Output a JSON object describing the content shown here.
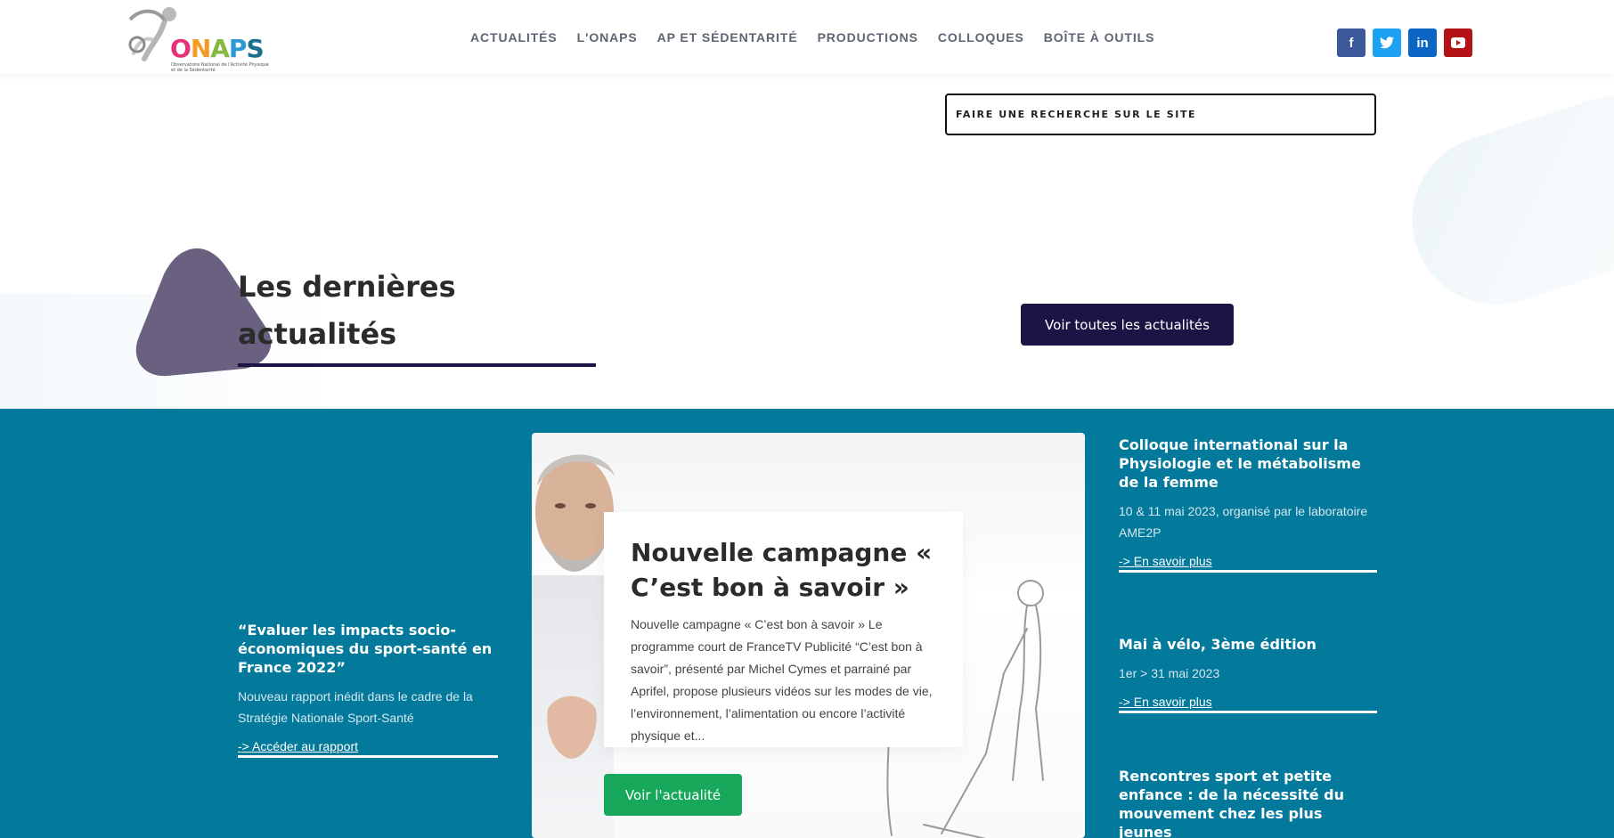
{
  "header": {
    "logo_letters": [
      "O",
      "N",
      "A",
      "P",
      "S"
    ],
    "logo_subtitle": "Observatoire National de l'Activité Physique et de la Sédentarité",
    "nav": [
      {
        "label": "ACTUALITÉS"
      },
      {
        "label": "L'ONAPS"
      },
      {
        "label": "AP ET SÉDENTARITÉ"
      },
      {
        "label": "PRODUCTIONS"
      },
      {
        "label": "COLLOQUES"
      },
      {
        "label": "BOÎTE À OUTILS"
      }
    ],
    "social": [
      {
        "icon": "facebook-icon",
        "glyph": "f",
        "color": "#3b5998"
      },
      {
        "icon": "twitter-icon",
        "glyph": "t",
        "color": "#1da1f2"
      },
      {
        "icon": "linkedin-icon",
        "glyph": "in",
        "color": "#0a66c2"
      },
      {
        "icon": "youtube-icon",
        "glyph": "▶",
        "color": "#b31217"
      }
    ]
  },
  "search": {
    "placeholder": "FAIRE UNE RECHERCHE SUR LE SITE"
  },
  "latest": {
    "title_line1": "Les dernières",
    "title_line2": "actualités",
    "all_news_button": "Voir toutes les actualités"
  },
  "left_article": {
    "title": "“Evaluer les impacts socio-économiques du sport-santé en France 2022”",
    "description": "Nouveau rapport inédit dans le cadre de la Stratégie Nationale Sport-Santé",
    "link": "-> Accéder au rapport"
  },
  "featured": {
    "title": "Nouvelle campagne « C’est bon à savoir »",
    "text": "Nouvelle campagne « C’est bon à savoir » Le programme court de FranceTV Publicité “C’est bon à savoir”, présenté par Michel Cymes et parrainé par Aprifel, propose plusieurs vidéos sur les modes de vie, l’environnement, l’alimentation ou encore l’activité physique et...",
    "button": "Voir l'actualité"
  },
  "events": [
    {
      "title": "Colloque international sur la Physiologie et le métabolisme de la femme",
      "meta": "10 & 11 mai 2023, organisé par le laboratoire AME2P",
      "link": "-> En savoir plus"
    },
    {
      "title": "Mai à vélo, 3ème édition",
      "meta": "1er > 31 mai 2023",
      "link": "-> En savoir plus"
    },
    {
      "title": "Rencontres sport et petite enfance : de la nécessité du mouvement chez les plus jeunes"
    }
  ],
  "colors": {
    "accent_dark": "#1d1446",
    "band_teal": "#03799c",
    "button_green": "#17a85c",
    "blob_purple": "#6a6180"
  }
}
